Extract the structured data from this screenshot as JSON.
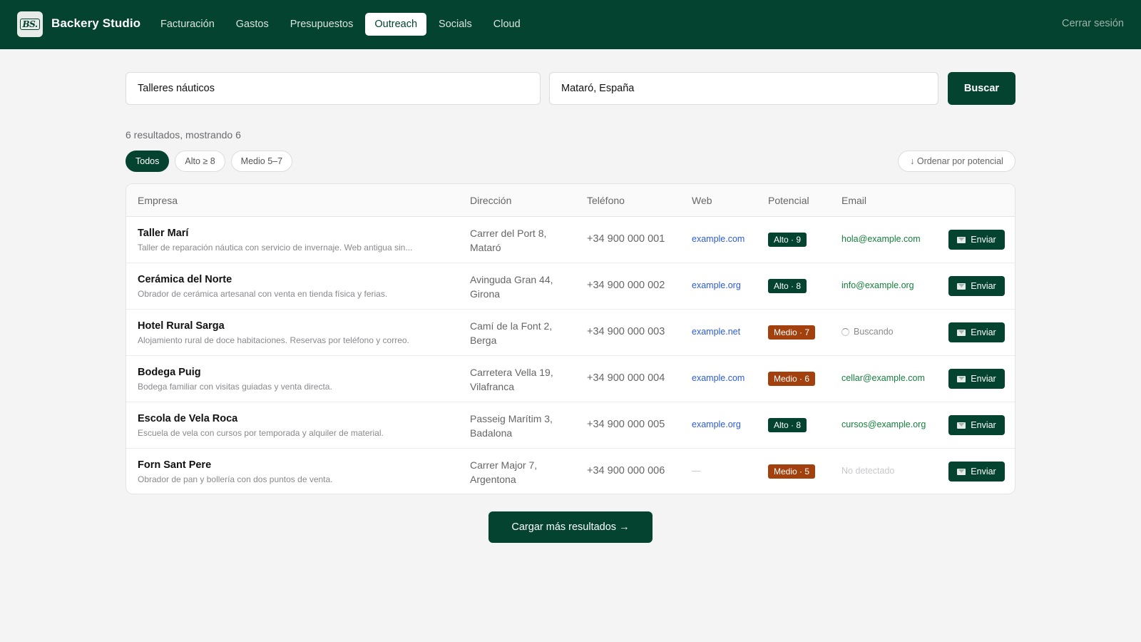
{
  "header": {
    "logo_text": "BS.",
    "brand": "Backery Studio",
    "nav": [
      {
        "label": "Facturación",
        "active": false
      },
      {
        "label": "Gastos",
        "active": false
      },
      {
        "label": "Presupuestos",
        "active": false
      },
      {
        "label": "Outreach",
        "active": true
      },
      {
        "label": "Socials",
        "active": false
      },
      {
        "label": "Cloud",
        "active": false
      }
    ],
    "logout": "Cerrar sesión"
  },
  "search": {
    "query_value": "Talleres náuticos",
    "location_value": "Mataró, España",
    "button": "Buscar"
  },
  "results": {
    "count_text": "6 resultados, mostrando 6",
    "filters": [
      {
        "label": "Todos",
        "active": true
      },
      {
        "label": "Alto ≥ 8",
        "active": false
      },
      {
        "label": "Medio 5–7",
        "active": false
      }
    ],
    "sort_label": "↓ Ordenar por potencial"
  },
  "table": {
    "columns": [
      "Empresa",
      "Dirección",
      "Teléfono",
      "Web",
      "Potencial",
      "Email"
    ],
    "send_label": "Enviar",
    "rows": [
      {
        "name": "Taller Marí",
        "desc": "Taller de reparación náutica con servicio de invernaje. Web antigua sin...",
        "addr1": "Carrer del Port 8,",
        "addr2": "Mataró",
        "phone": "+34 900 000 001",
        "web": "example.com",
        "potential": "Alto · 9",
        "level": "alto",
        "email": "hola@example.com",
        "email_state": "found"
      },
      {
        "name": "Cerámica del Norte",
        "desc": "Obrador de cerámica artesanal con venta en tienda física y ferias.",
        "addr1": "Avinguda Gran 44,",
        "addr2": "Girona",
        "phone": "+34 900 000 002",
        "web": "example.org",
        "potential": "Alto · 8",
        "level": "alto",
        "email": "info@example.org",
        "email_state": "found"
      },
      {
        "name": "Hotel Rural Sarga",
        "desc": "Alojamiento rural de doce habitaciones. Reservas por teléfono y correo.",
        "addr1": "Camí de la Font 2,",
        "addr2": "Berga",
        "phone": "+34 900 000 003",
        "web": "example.net",
        "potential": "Medio · 7",
        "level": "medio",
        "email": "Buscando",
        "email_state": "searching"
      },
      {
        "name": "Bodega Puig",
        "desc": "Bodega familiar con visitas guiadas y venta directa.",
        "addr1": "Carretera Vella 19,",
        "addr2": "Vilafranca",
        "phone": "+34 900 000 004",
        "web": "example.com",
        "potential": "Medio · 6",
        "level": "medio",
        "email": "cellar@example.com",
        "email_state": "found"
      },
      {
        "name": "Escola de Vela Roca",
        "desc": "Escuela de vela con cursos por temporada y alquiler de material.",
        "addr1": "Passeig Marítim 3,",
        "addr2": "Badalona",
        "phone": "+34 900 000 005",
        "web": "example.org",
        "potential": "Alto · 8",
        "level": "alto",
        "email": "cursos@example.org",
        "email_state": "found"
      },
      {
        "name": "Forn Sant Pere",
        "desc": "Obrador de pan y bollería con dos puntos de venta.",
        "addr1": "Carrer Major 7,",
        "addr2": "Argentona",
        "phone": "+34 900 000 006",
        "web": "—",
        "potential": "Medio · 5",
        "level": "medio",
        "email": "No detectado",
        "email_state": "missing"
      }
    ]
  },
  "load_more": "Cargar más resultados →",
  "colors": {
    "brand": "#03432f",
    "medium_badge": "#a3410e",
    "link": "#2a5bd7",
    "email": "#15803d"
  }
}
